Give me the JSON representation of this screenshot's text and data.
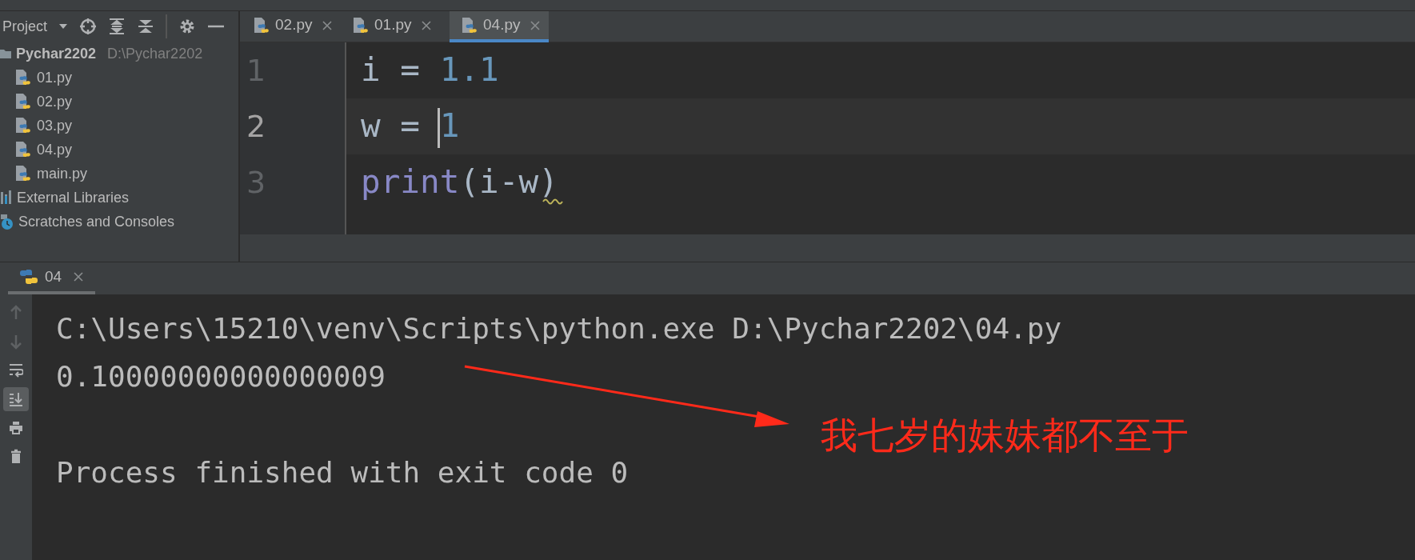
{
  "project_panel": {
    "title": "Project",
    "tree": [
      {
        "name": "Pychar2202",
        "path": "D:\\Pychar2202",
        "kind": "folder",
        "children": [
          {
            "name": "01.py",
            "kind": "python_file"
          },
          {
            "name": "02.py",
            "kind": "python_file"
          },
          {
            "name": "03.py",
            "kind": "python_file"
          },
          {
            "name": "04.py",
            "kind": "python_file"
          },
          {
            "name": "main.py",
            "kind": "python_file"
          }
        ]
      },
      {
        "name": "External Libraries",
        "kind": "libraries"
      },
      {
        "name": "Scratches and Consoles",
        "kind": "scratches"
      }
    ]
  },
  "editor": {
    "tabs": [
      {
        "label": "02.py",
        "selected": false
      },
      {
        "label": "01.py",
        "selected": false
      },
      {
        "label": "04.py",
        "selected": true
      }
    ],
    "lines": [
      {
        "number": "1",
        "current": false,
        "tokens": [
          {
            "text": "i",
            "kind": "identifier"
          },
          {
            "text": " = ",
            "kind": "operator"
          },
          {
            "text": "1.1",
            "kind": "number"
          }
        ]
      },
      {
        "number": "2",
        "current": true,
        "tokens": [
          {
            "text": "w",
            "kind": "identifier"
          },
          {
            "text": " = ",
            "kind": "operator"
          },
          {
            "text": "1",
            "kind": "number",
            "caret": true
          }
        ]
      },
      {
        "number": "3",
        "current": false,
        "tokens": [
          {
            "text": "print",
            "kind": "builtin"
          },
          {
            "text": "(i-w",
            "kind": "identifier"
          },
          {
            "text": ")",
            "kind": "identifier",
            "warning": true
          }
        ]
      }
    ]
  },
  "run_panel": {
    "tabs": [
      {
        "label": "04",
        "selected": true
      }
    ],
    "toolbar": [
      {
        "kind": "up",
        "disabled": true,
        "on": false
      },
      {
        "kind": "down",
        "disabled": true,
        "on": false
      },
      {
        "kind": "wrap",
        "disabled": false,
        "on": false
      },
      {
        "kind": "scroll_end",
        "disabled": false,
        "on": true
      },
      {
        "kind": "print",
        "disabled": false,
        "on": false
      },
      {
        "kind": "clear",
        "disabled": false,
        "on": false
      }
    ],
    "console": [
      {
        "kind": "output",
        "text": "C:\\Users\\15210\\venv\\Scripts\\python.exe D:\\Pychar2202\\04.py"
      },
      {
        "kind": "output",
        "text": "0.10000000000000009"
      },
      {
        "kind": "blank"
      },
      {
        "kind": "output",
        "text": "Process finished with exit code 0"
      }
    ]
  },
  "annotation": {
    "text": "我七岁的妹妹都不至于"
  }
}
